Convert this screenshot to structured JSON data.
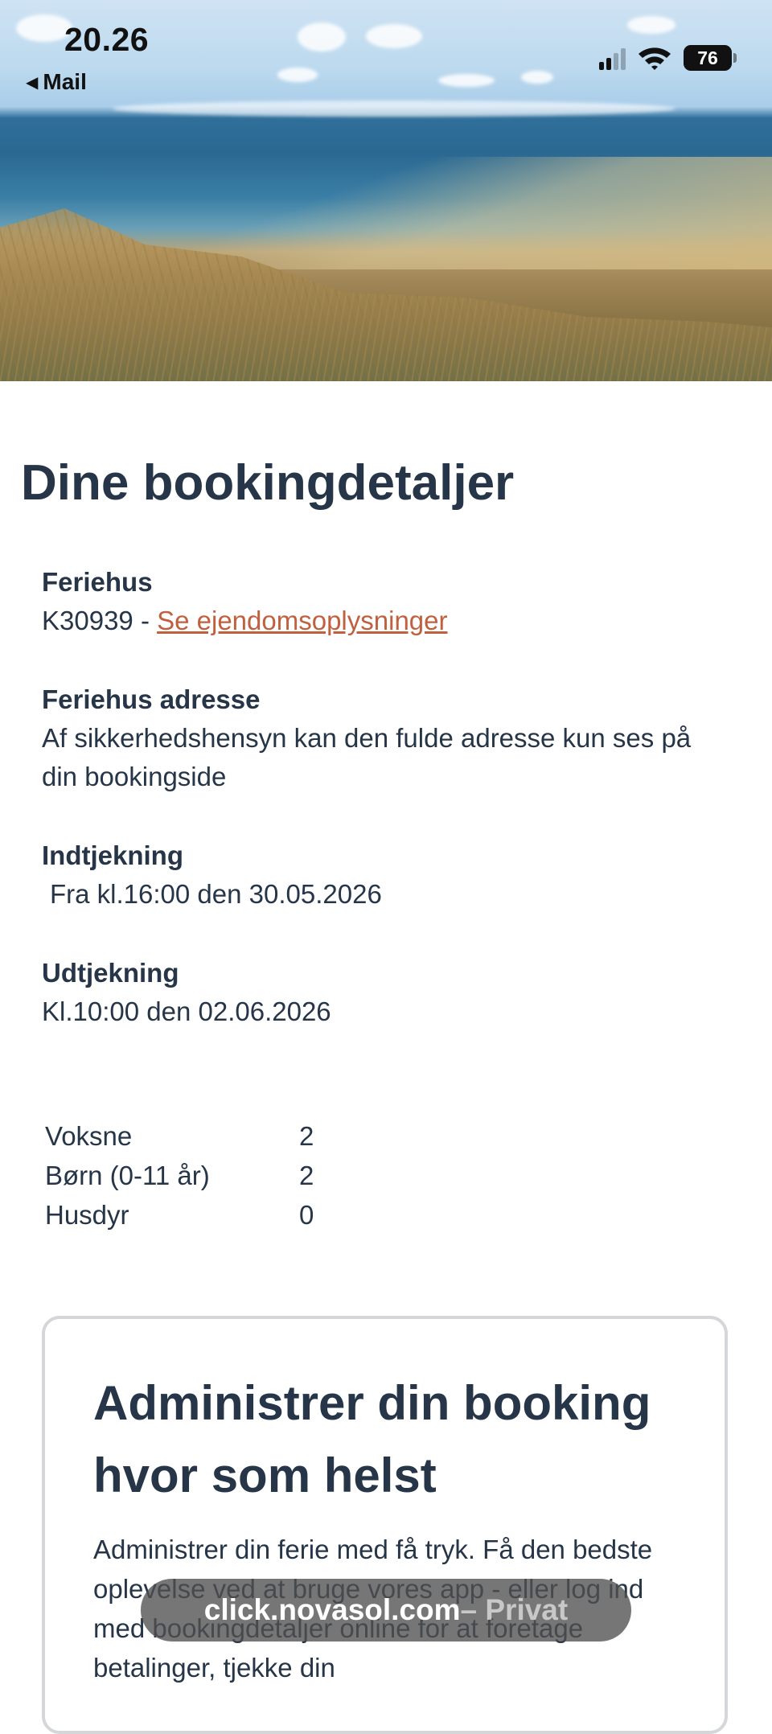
{
  "status_bar": {
    "time": "20.26",
    "back_label": "Mail",
    "battery": "76"
  },
  "page": {
    "title": "Dine bookingdetaljer"
  },
  "details": {
    "house_label": "Feriehus",
    "house_id": "K30939 - ",
    "house_link": "Se ejendomsoplysninger",
    "address_label": "Feriehus adresse",
    "address_value": "Af sikkerhedshensyn kan den fulde adresse kun ses på din bookingside",
    "checkin_label": "Indtjekning",
    "checkin_value": "Fra kl.16:00 den 30.05.2026",
    "checkout_label": "Udtjekning",
    "checkout_value": "Kl.10:00 den 02.06.2026"
  },
  "guests": {
    "labels": [
      "Voksne",
      "Børn (0-11 år)",
      "Husdyr"
    ],
    "values": [
      "2",
      "2",
      "0"
    ]
  },
  "manage_card": {
    "title": "Administrer din booking hvor som helst",
    "body": "Administrer din ferie med få tryk. Få den bedste oplevelse ved at bruge vores app - eller log ind med bookingdetaljer online for at foretage betalinger, tjekke din"
  },
  "browser": {
    "url": "click.novasol.com",
    "mode": " – Privat"
  }
}
